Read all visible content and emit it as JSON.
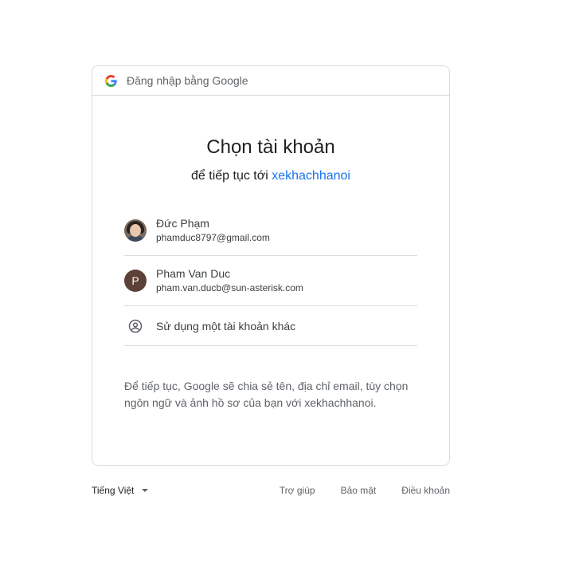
{
  "header": {
    "text": "Đăng nhập bằng Google",
    "logo_icon": "google-g-icon"
  },
  "main": {
    "title": "Chọn tài khoản",
    "subtitle_prefix": "để tiếp tục tới",
    "app_name": "xekhachhanoi"
  },
  "accounts": [
    {
      "name": "Đức Phạm",
      "email": "phamduc8797@gmail.com",
      "avatar": "photo"
    },
    {
      "name": "Pham Van Duc",
      "email": "pham.van.ducb@sun-asterisk.com",
      "avatar_letter": "P",
      "avatar_color": "#5d4037"
    }
  ],
  "other_account": {
    "label": "Sử dụng một tài khoản khác",
    "icon": "account-circle-icon"
  },
  "disclaimer": "Để tiếp tục, Google sẽ chia sẻ tên, địa chỉ email, tùy chọn ngôn ngữ và ảnh hồ sơ của bạn với xekhachhanoi.",
  "footer": {
    "language": "Tiếng Việt",
    "links": [
      "Trợ giúp",
      "Bảo mật",
      "Điều khoản"
    ]
  },
  "colors": {
    "accent": "#1a73e8",
    "border": "#dadce0",
    "muted": "#5f6368"
  }
}
